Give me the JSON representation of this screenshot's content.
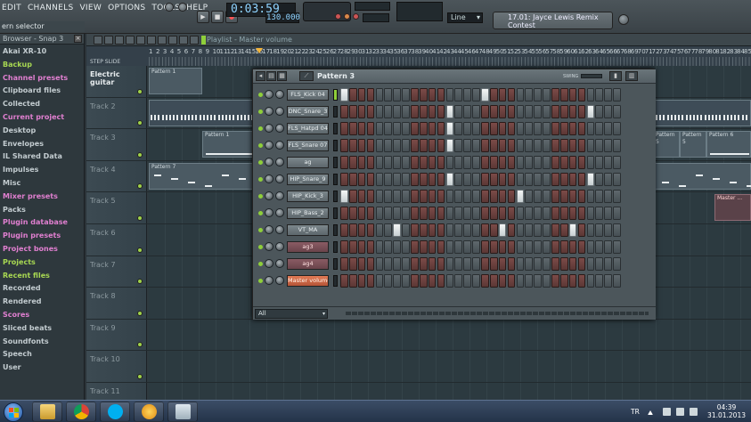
{
  "menu": [
    "EDIT",
    "CHANNELS",
    "VIEW",
    "OPTIONS",
    "TOOLS",
    "HELP"
  ],
  "transport": {
    "time": "0:03:59",
    "tempo": "130.000"
  },
  "snap": {
    "value": "Line"
  },
  "hint": {
    "line1": "17.01: Jayce Lewis Remix",
    "line2": "Contest"
  },
  "browser": {
    "title": "Browser - Snap 3",
    "header_partial": "ern selector",
    "items": [
      {
        "label": "Akai XR-10",
        "color": "white"
      },
      {
        "label": "Backup",
        "color": "green"
      },
      {
        "label": "Channel presets",
        "color": "pink"
      },
      {
        "label": "Clipboard files",
        "color": "white"
      },
      {
        "label": "Collected",
        "color": "white"
      },
      {
        "label": "Current project",
        "color": "pink"
      },
      {
        "label": "Desktop",
        "color": "white"
      },
      {
        "label": "Envelopes",
        "color": "white"
      },
      {
        "label": "IL Shared Data",
        "color": "white"
      },
      {
        "label": "Impulses",
        "color": "white"
      },
      {
        "label": "Misc",
        "color": "white"
      },
      {
        "label": "Mixer presets",
        "color": "pink"
      },
      {
        "label": "Packs",
        "color": "white"
      },
      {
        "label": "Plugin database",
        "color": "pink"
      },
      {
        "label": "Plugin presets",
        "color": "pink"
      },
      {
        "label": "Project bones",
        "color": "pink"
      },
      {
        "label": "Projects",
        "color": "green"
      },
      {
        "label": "Recent files",
        "color": "green"
      },
      {
        "label": "Recorded",
        "color": "white"
      },
      {
        "label": "Rendered",
        "color": "white"
      },
      {
        "label": "Scores",
        "color": "pink"
      },
      {
        "label": "Sliced beats",
        "color": "white"
      },
      {
        "label": "Soundfonts",
        "color": "white"
      },
      {
        "label": "Speech",
        "color": "white"
      },
      {
        "label": "User",
        "color": "white"
      }
    ]
  },
  "playlist": {
    "title": "Playlist - Master volume",
    "step_slide": "STEP  SLIDE",
    "ruler": [
      "1",
      "2",
      "3",
      "4",
      "5",
      "6",
      "7",
      "8",
      "9",
      "10",
      "11",
      "12",
      "13",
      "14",
      "15",
      "16",
      "17",
      "18",
      "19",
      "20",
      "21",
      "22",
      "23",
      "24",
      "25",
      "26",
      "27",
      "28",
      "29",
      "30",
      "31",
      "32",
      "33",
      "34",
      "35",
      "36",
      "37",
      "38",
      "39",
      "40",
      "41",
      "42",
      "43",
      "44",
      "45",
      "46",
      "47",
      "48",
      "49",
      "50",
      "51",
      "52",
      "53",
      "54",
      "55",
      "56",
      "57",
      "58",
      "59",
      "60",
      "61",
      "62",
      "63",
      "64",
      "65",
      "66",
      "67",
      "68",
      "69",
      "70",
      "71",
      "72",
      "73",
      "74",
      "75",
      "76",
      "77",
      "78",
      "79",
      "80",
      "81",
      "82",
      "83",
      "84",
      "85"
    ],
    "tracks": [
      {
        "name": "Electric guitar"
      },
      {
        "name": "Track 2"
      },
      {
        "name": "Track 3"
      },
      {
        "name": "Track 4"
      },
      {
        "name": "Track 5"
      },
      {
        "name": "Track 6"
      },
      {
        "name": "Track 7"
      },
      {
        "name": "Track 8"
      },
      {
        "name": "Track 9"
      },
      {
        "name": "Track 10"
      },
      {
        "name": "Track 11"
      }
    ],
    "clips": {
      "pattern1": "Pattern 1",
      "pattern5": "Pattern 5",
      "pattern6": "Pattern 6",
      "pattern7": "Pattern 7",
      "master": "Master ..."
    }
  },
  "sequencer": {
    "title": "Pattern 3",
    "swing": "SWING",
    "filter": "All",
    "channels": [
      {
        "name": "FLS_Kick 04",
        "style": "grey",
        "steps": "1000000000000000100000000000000010000000000000001000000000000000"
      },
      {
        "name": "DNC_Snare_3",
        "style": "grey",
        "steps": "0000000000001000000000000000100000000000000010000000000000001000"
      },
      {
        "name": "FLS_Hatpd 04",
        "style": "grey",
        "steps": "0000000000001000000000000000000000000000000000000000000000001000"
      },
      {
        "name": "FLS_Snare 07",
        "style": "grey",
        "steps": "0000000000001000000000000000000000000000000000000000000000000000"
      },
      {
        "name": "ag",
        "style": "grey",
        "steps": "0000000000000000000000000000000000000000000000000000000000000000"
      },
      {
        "name": "HIP_Snare_9",
        "style": "grey",
        "steps": "0000000000001000000000000000100000000000000000000000000000000000"
      },
      {
        "name": "HIP_Kick_3",
        "style": "grey",
        "steps": "1000000000000000000010000000000000000000000010000000000000000000"
      },
      {
        "name": "HIP_Bass_2",
        "style": "grey",
        "steps": "0000000000000000000000000000000000000000000000000000000000000000"
      },
      {
        "name": "VT_MA",
        "style": "grey",
        "steps": "0000001000000000001000000010000000000000000000000000000000000000"
      },
      {
        "name": "ag3",
        "style": "red",
        "steps": "0000000000000000000000000000000000000000000000000000000000000000"
      },
      {
        "name": "ag4",
        "style": "red",
        "steps": "0000000000000000000000000000000000000000000000000000000000000000"
      },
      {
        "name": "Master volume",
        "style": "orange",
        "steps": "0000000000000000000000000000000000000000000000000000000000000000"
      }
    ]
  },
  "taskbar": {
    "lang": "TR",
    "time": "04:39",
    "date": "31.01.2013",
    "apps": [
      "explorer",
      "chrome",
      "skype",
      "fl-studio",
      "documents"
    ]
  },
  "colors": {
    "step_on": "#f0f3f4",
    "step_off": "#6b403e",
    "accent_green": "#a8d852",
    "accent_pink": "#e07fd0"
  }
}
